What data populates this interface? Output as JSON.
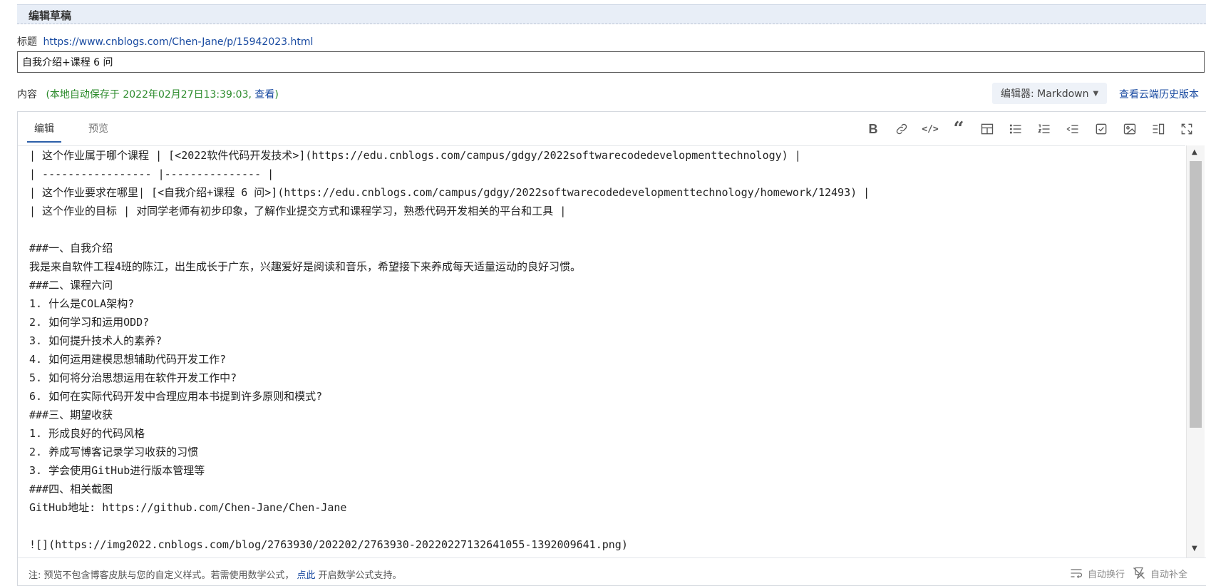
{
  "header": {
    "title": "编辑草稿"
  },
  "title_row": {
    "label": "标题",
    "url": "https://www.cnblogs.com/Chen-Jane/p/15942023.html",
    "input_value": "自我介绍+课程 6 问"
  },
  "content_row": {
    "label": "内容",
    "autosave_text": "(本地自动保存于 2022年02月27日13:39:03,",
    "view_link": "查看",
    "autosave_close": ")",
    "editor_select": "编辑器: Markdown",
    "history_link": "查看云端历史版本"
  },
  "tabs": [
    {
      "label": "编辑",
      "active": true
    },
    {
      "label": "预览",
      "active": false
    }
  ],
  "toolbar": {
    "icons": [
      "bold-icon",
      "link-icon",
      "code-icon",
      "quote-icon",
      "table-icon",
      "bullet-list-icon",
      "numbered-list-icon",
      "indent-icon",
      "checkbox-icon",
      "image-icon",
      "split-view-icon",
      "fullscreen-icon"
    ],
    "bold_glyph": "B",
    "quote_glyph": "“",
    "code_glyph": "</>"
  },
  "editor_lines": [
    "| 这个作业属于哪个课程 | [<2022软件代码开发技术>](https://edu.cnblogs.com/campus/gdgy/2022softwarecodedevelopmenttechnology) |",
    "| ----------------- |--------------- |",
    "| 这个作业要求在哪里| [<自我介绍+课程 6 问>](https://edu.cnblogs.com/campus/gdgy/2022softwarecodedevelopmenttechnology/homework/12493) |",
    "| 这个作业的目标 | 对同学老师有初步印象，了解作业提交方式和课程学习，熟悉代码开发相关的平台和工具 |",
    "",
    "###一、自我介绍",
    "我是来自软件工程4班的陈江，出生成长于广东，兴趣爱好是阅读和音乐，希望接下来养成每天适量运动的良好习惯。",
    "###二、课程六问",
    "1. 什么是COLA架构?",
    "2. 如何学习和运用ODD?",
    "3. 如何提升技术人的素养?",
    "4. 如何运用建模思想辅助代码开发工作?",
    "5. 如何将分治思想运用在软件开发工作中?",
    "6. 如何在实际代码开发中合理应用本书提到许多原则和模式?",
    "###三、期望收获",
    "1. 形成良好的代码风格",
    "2. 养成写博客记录学习收获的习惯",
    "3. 学会使用GitHub进行版本管理等",
    "###四、相关截图",
    "GitHub地址: https://github.com/Chen-Jane/Chen-Jane",
    "",
    "![](https://img2022.cnblogs.com/blog/2763930/202202/2763930-20220227132641055-1392009641.png)"
  ],
  "footer": {
    "note_prefix": "注: 预览不包含博客皮肤与您的自定义样式。若需使用数学公式，",
    "note_link": "点此",
    "note_suffix": "开启数学公式支持。",
    "wrap_label": "自动换行",
    "autocomplete_label": "自动补全"
  }
}
